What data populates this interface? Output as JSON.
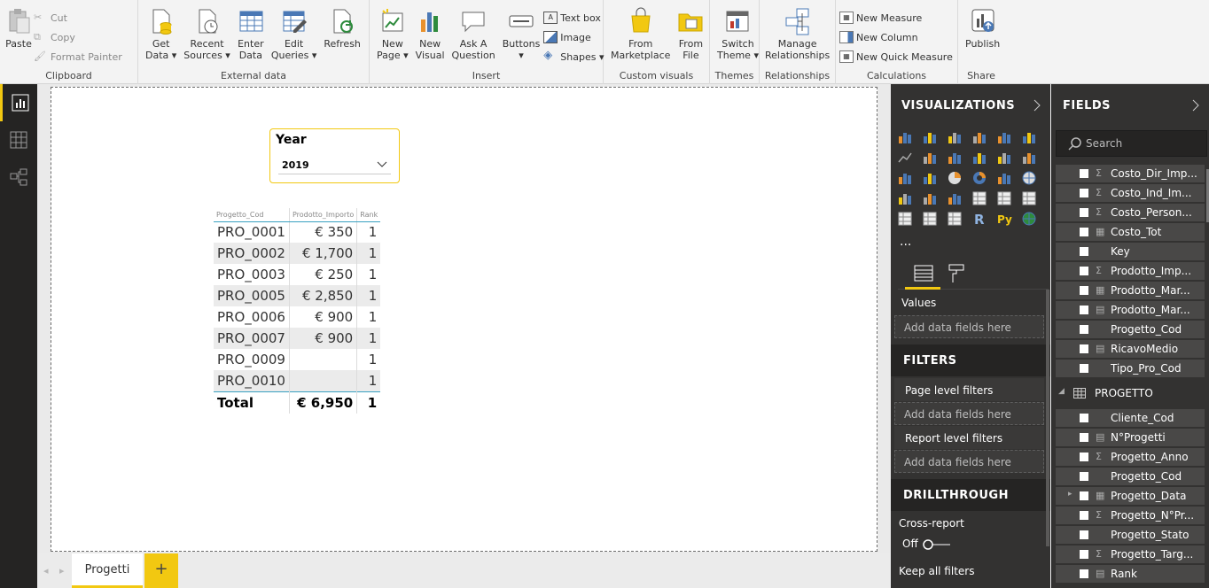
{
  "ribbon": {
    "clipboard": {
      "label": "Clipboard",
      "paste": "Paste",
      "cut": "Cut",
      "copy": "Copy",
      "format_painter": "Format Painter"
    },
    "external_data": {
      "label": "External data",
      "get_data": "Get",
      "get_data2": "Data",
      "recent": "Recent",
      "recent2": "Sources",
      "enter": "Enter",
      "enter2": "Data",
      "edit": "Edit",
      "edit2": "Queries",
      "refresh": "Refresh"
    },
    "insert": {
      "label": "Insert",
      "new_page": "New",
      "new_page2": "Page",
      "new_visual": "New",
      "new_visual2": "Visual",
      "ask": "Ask A",
      "ask2": "Question",
      "buttons": "Buttons",
      "text_box": "Text box",
      "image": "Image",
      "shapes": "Shapes"
    },
    "custom_visuals": {
      "label": "Custom visuals",
      "marketplace": "From",
      "marketplace2": "Marketplace",
      "file": "From",
      "file2": "File"
    },
    "themes": {
      "label": "Themes",
      "switch": "Switch",
      "switch2": "Theme"
    },
    "relationships": {
      "label": "Relationships",
      "manage": "Manage",
      "manage2": "Relationships"
    },
    "calculations": {
      "label": "Calculations",
      "new_measure": "New Measure",
      "new_column": "New Column",
      "new_quick_measure": "New Quick Measure"
    },
    "share": {
      "label": "Share",
      "publish": "Publish"
    }
  },
  "slicer": {
    "title": "Year",
    "value": "2019"
  },
  "table": {
    "headers": [
      "Progetto_Cod",
      "Prodotto_Importo",
      "Rank"
    ],
    "rows": [
      [
        "PRO_0001",
        "€ 350",
        "1"
      ],
      [
        "PRO_0002",
        "€ 1,700",
        "1"
      ],
      [
        "PRO_0003",
        "€ 250",
        "1"
      ],
      [
        "PRO_0005",
        "€ 2,850",
        "1"
      ],
      [
        "PRO_0006",
        "€ 900",
        "1"
      ],
      [
        "PRO_0007",
        "€ 900",
        "1"
      ],
      [
        "PRO_0009",
        "",
        "1"
      ],
      [
        "PRO_0010",
        "",
        "1"
      ]
    ],
    "total": [
      "Total",
      "€ 6,950",
      "1"
    ]
  },
  "tabs": {
    "page1": "Progetti",
    "add": "+"
  },
  "visualizations": {
    "title": "VISUALIZATIONS",
    "values_label": "Values",
    "drop_text": "Add data fields here",
    "filters_title": "FILTERS",
    "page_filters": "Page level filters",
    "report_filters": "Report level filters",
    "drillthrough_title": "DRILLTHROUGH",
    "cross_report": "Cross-report",
    "toggle_state": "Off",
    "keep_all": "Keep all filters",
    "more": "..."
  },
  "fields": {
    "title": "FIELDS",
    "search_placeholder": "Search",
    "group1": [
      {
        "name": "Costo_Dir_Imp...",
        "type": "sigma"
      },
      {
        "name": "Costo_Ind_Im...",
        "type": "sigma"
      },
      {
        "name": "Costo_Person...",
        "type": "sigma"
      },
      {
        "name": "Costo_Tot",
        "type": "calc"
      },
      {
        "name": "Key",
        "type": "none"
      },
      {
        "name": "Prodotto_Imp...",
        "type": "sigma"
      },
      {
        "name": "Prodotto_Mar...",
        "type": "calc"
      },
      {
        "name": "Prodotto_Mar...",
        "type": "measure"
      },
      {
        "name": "Progetto_Cod",
        "type": "none"
      },
      {
        "name": "RicavoMedio",
        "type": "measure"
      },
      {
        "name": "Tipo_Pro_Cod",
        "type": "none"
      }
    ],
    "table2_name": "PROGETTO",
    "group2": [
      {
        "name": "Cliente_Cod",
        "type": "none"
      },
      {
        "name": "N°Progetti",
        "type": "measure"
      },
      {
        "name": "Progetto_Anno",
        "type": "sigma"
      },
      {
        "name": "Progetto_Cod",
        "type": "none"
      },
      {
        "name": "Progetto_Data",
        "type": "calc"
      },
      {
        "name": "Progetto_N°Pr...",
        "type": "sigma"
      },
      {
        "name": "Progetto_Stato",
        "type": "none"
      },
      {
        "name": "Progetto_Targ...",
        "type": "sigma"
      },
      {
        "name": "Rank",
        "type": "measure"
      }
    ]
  },
  "colors": {
    "accent": "#f2c811",
    "pane": "#333231",
    "header": "#252423",
    "table_line": "#3aa1c1"
  }
}
